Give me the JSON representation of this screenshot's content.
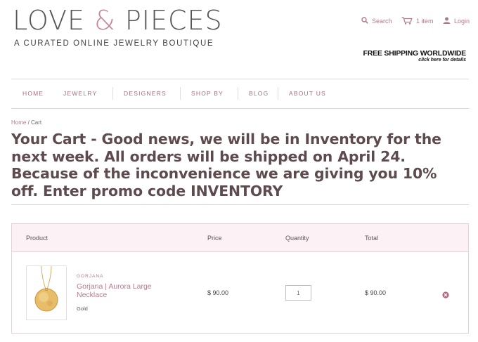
{
  "brand": {
    "logo_part1": "LOVE ",
    "logo_amp": "&",
    "logo_part2": " PIECES",
    "tagline": "A CURATED ONLINE JEWELRY BOUTIQUE"
  },
  "utility": {
    "search_label": "Search",
    "cart_label": "1 item",
    "login_label": "Login"
  },
  "promo": {
    "main": "FREE SHIPPING WORLDWIDE",
    "sub": "click here for details"
  },
  "nav": {
    "items": [
      "HOME",
      "JEWELRY",
      "DESIGNERS",
      "SHOP BY",
      "BLOG",
      "ABOUT US"
    ]
  },
  "breadcrumb": {
    "home": "Home",
    "separator": " / ",
    "current": "Cart"
  },
  "page_title": "Your Cart - Good news, we will be in Inventory for the next week. All orders will be shipped on April 24. Because of the inconvenience we are giving you 10% off. Enter promo code INVENTORY",
  "cart": {
    "headers": {
      "product": "Product",
      "price": "Price",
      "quantity": "Quantity",
      "total": "Total"
    },
    "items": [
      {
        "brand": "GORJANA",
        "name": "Gorjana | Aurora Large Necklace",
        "variant": "Gold",
        "price": "$ 90.00",
        "quantity": "1",
        "total": "$ 90.00"
      }
    ]
  },
  "colors": {
    "accent": "#b07a8e",
    "header_bg": "#fcf1f5",
    "title": "#5e4b4e"
  },
  "icons": [
    "search-icon",
    "cart-icon",
    "user-icon",
    "remove-icon"
  ]
}
